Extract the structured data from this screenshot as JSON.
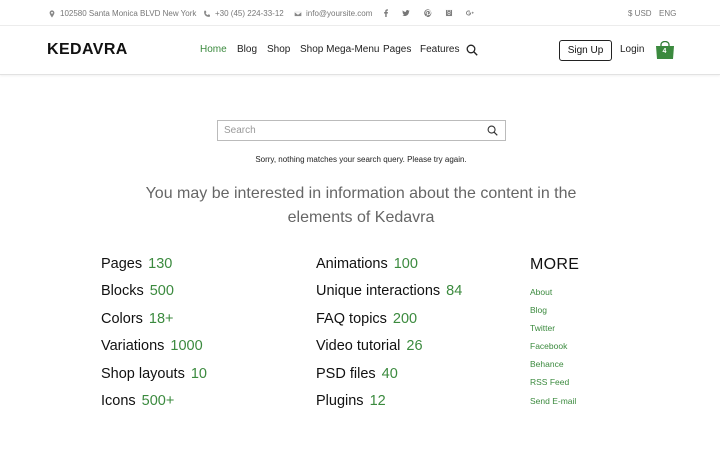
{
  "topbar": {
    "address": "102580 Santa Monica BLVD New York",
    "phone": "+30 (45) 224-33-12",
    "email": "info@yoursite.com",
    "social": [
      "facebook-icon",
      "twitter-icon",
      "pinterest-icon",
      "instagram-icon",
      "google-plus-icon"
    ],
    "currency": "$ USD",
    "language": "ENG"
  },
  "header": {
    "logo": "KEDAVRA",
    "nav": [
      "Home",
      "Blog",
      "Shop",
      "Shop Mega-Menu",
      "Pages",
      "Features"
    ],
    "signup": "Sign Up",
    "login": "Login",
    "cart_count": "4"
  },
  "search": {
    "placeholder": "Search",
    "message": "Sorry, nothing matches your search query. Please try again."
  },
  "lead": "You may be interested in information about the content in the elements of Kedavra",
  "stats_col1": [
    {
      "label": "Pages",
      "value": "130"
    },
    {
      "label": "Blocks",
      "value": "500"
    },
    {
      "label": "Colors",
      "value": "18+"
    },
    {
      "label": "Variations",
      "value": "1000"
    },
    {
      "label": "Shop layouts",
      "value": "10"
    },
    {
      "label": "Icons",
      "value": "500+"
    }
  ],
  "stats_col2": [
    {
      "label": "Animations",
      "value": "100"
    },
    {
      "label": "Unique interactions",
      "value": "84"
    },
    {
      "label": "FAQ topics",
      "value": "200"
    },
    {
      "label": "Video tutorial",
      "value": "26"
    },
    {
      "label": "PSD files",
      "value": "40"
    },
    {
      "label": "Plugins",
      "value": "12"
    }
  ],
  "more": {
    "title": "MORE",
    "links": [
      "About",
      "Blog",
      "Twitter",
      "Facebook",
      "Behance",
      "RSS Feed",
      "Send E-mail"
    ]
  },
  "colors": {
    "accent": "#3b8a3e"
  }
}
